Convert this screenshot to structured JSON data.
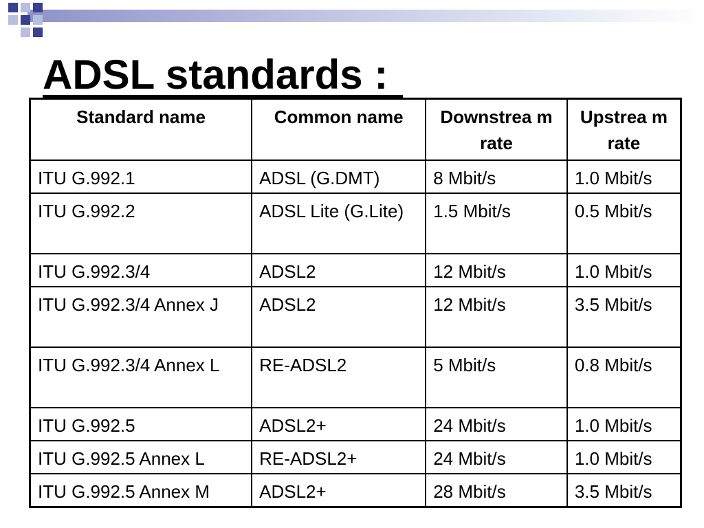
{
  "slide": {
    "title": "ADSL standards :"
  },
  "table": {
    "headers": [
      "Standard name",
      "Common name",
      "Downstrea m rate",
      "Upstrea m rate"
    ],
    "rows": [
      [
        "ITU G.992.1",
        "ADSL (G.DMT)",
        "8 Mbit/s",
        "1.0 Mbit/s"
      ],
      [
        "ITU G.992.2",
        "ADSL Lite (G.Lite)",
        "1.5 Mbit/s",
        "0.5 Mbit/s"
      ],
      [
        "ITU G.992.3/4",
        "ADSL2",
        "12 Mbit/s",
        "1.0 Mbit/s"
      ],
      [
        "ITU G.992.3/4 Annex J",
        "ADSL2",
        "12 Mbit/s",
        "3.5 Mbit/s"
      ],
      [
        "ITU G.992.3/4 Annex L",
        "RE-ADSL2",
        "5 Mbit/s",
        "0.8 Mbit/s"
      ],
      [
        "ITU G.992.5",
        "ADSL2+",
        "24 Mbit/s",
        "1.0 Mbit/s"
      ],
      [
        "ITU G.992.5 Annex L",
        "RE-ADSL2+",
        "24 Mbit/s",
        "1.0 Mbit/s"
      ],
      [
        "ITU G.992.5 Annex M",
        "ADSL2+",
        "28 Mbit/s",
        "3.5 Mbit/s"
      ]
    ]
  },
  "colors": {
    "accent_dark": "#3a3f8f",
    "accent_light": "#b9bde0",
    "band": "#c8cbe6"
  }
}
